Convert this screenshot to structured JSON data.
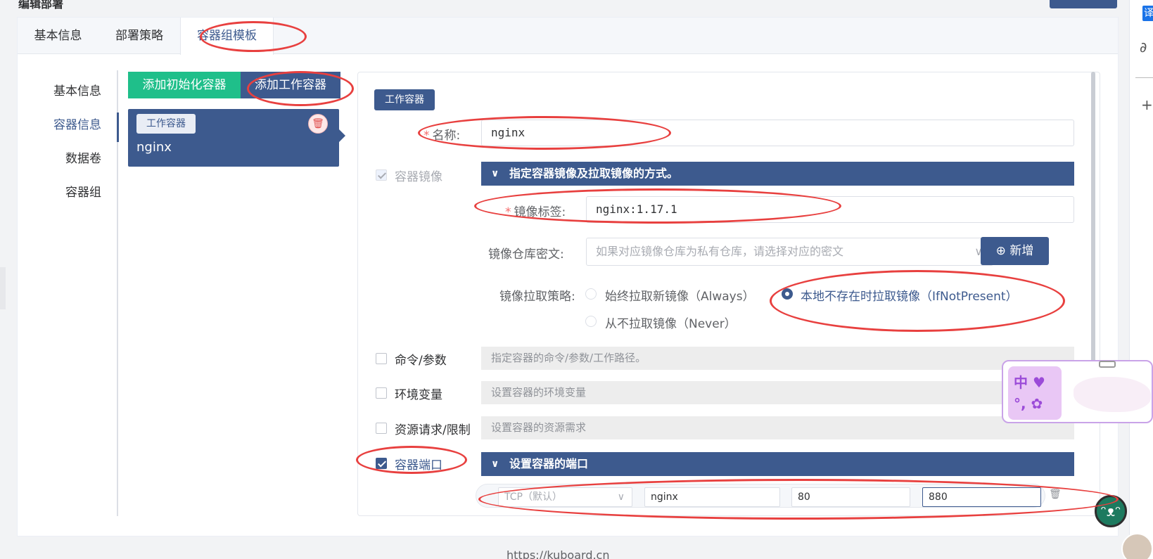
{
  "page": {
    "title": "编辑部署",
    "footer_url": "https://kuboard.cn"
  },
  "tabs": [
    {
      "label": "基本信息",
      "active": false
    },
    {
      "label": "部署策略",
      "active": false
    },
    {
      "label": "容器组模板",
      "active": true
    }
  ],
  "steps": [
    {
      "label": "基本信息",
      "active": false
    },
    {
      "label": "容器信息",
      "active": true
    },
    {
      "label": "数据卷",
      "active": false
    },
    {
      "label": "容器组",
      "active": false
    }
  ],
  "container_list": {
    "add_init_label": "添加初始化容器",
    "add_work_label": "添加工作容器",
    "selected": {
      "type_tag": "工作容器",
      "name": "nginx"
    }
  },
  "form": {
    "type_badge": "工作容器",
    "name_label": "名称:",
    "name_value": "nginx",
    "image_section": {
      "checkbox_label": "容器镜像",
      "bar_title": "指定容器镜像及拉取镜像的方式。",
      "tag_label": "镜像标签:",
      "tag_value": "nginx:1.17.1",
      "secret_label": "镜像仓库密文:",
      "secret_placeholder": "如果对应镜像仓库为私有仓库，请选择对应的密文",
      "new_button": "新增",
      "pull_policy_label": "镜像拉取策略:",
      "pull_policies": [
        {
          "label": "始终拉取新镜像（Always）",
          "selected": false
        },
        {
          "label": "本地不存在时拉取镜像（IfNotPresent）",
          "selected": true
        },
        {
          "label": "从不拉取镜像（Never）",
          "selected": false
        }
      ]
    },
    "optional_sections": [
      {
        "label": "命令/参数",
        "checked": false,
        "hint": "指定容器的命令/参数/工作路径。"
      },
      {
        "label": "环境变量",
        "checked": false,
        "hint": "设置容器的环境变量"
      },
      {
        "label": "资源请求/限制",
        "checked": false,
        "hint": "设置容器的资源需求"
      }
    ],
    "ports_section": {
      "checkbox_label": "容器端口",
      "checked": true,
      "bar_title": "设置容器的端口",
      "row": {
        "protocol_placeholder": "TCP（默认）",
        "name": "nginx",
        "container_port": "80",
        "host_port": "880"
      }
    }
  },
  "side_toolbar": {
    "translate_label": "译"
  },
  "widget": {
    "pad_text": "中 ♥ °, ✿"
  },
  "colors": {
    "primary": "#3d5a8e",
    "success": "#1fbf8a",
    "annotation": "#e8403f",
    "danger": "#e0504f"
  }
}
